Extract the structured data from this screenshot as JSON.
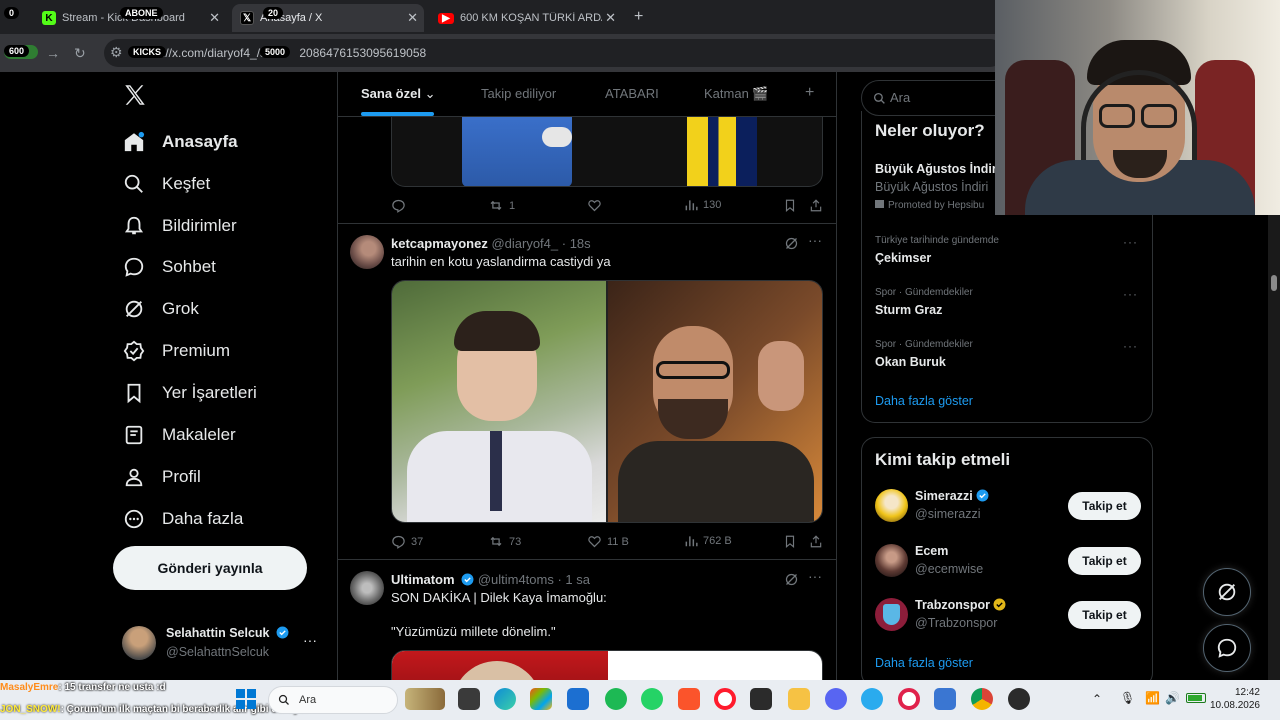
{
  "browser": {
    "tabs": [
      {
        "label": "Stream - Kick Dashboard",
        "active": false
      },
      {
        "label": "Anasayfa / X",
        "active": true
      },
      {
        "label": "600 KM KOŞAN TÜRKİ ARDA S...",
        "active": false
      }
    ],
    "new_tab": "+",
    "url": "https://x.com/diaryof4_/status/2086476153095619058",
    "url_display": "://x.com/diaryof4_/st",
    "url_display_tail": "2086476153095619058"
  },
  "overlays": {
    "abone": "ABONE",
    "abone_count": "20",
    "left_count": "0",
    "kicks": "KICKS",
    "kicks_count": "5000",
    "views": "600"
  },
  "sidebar": {
    "items": [
      {
        "label": "Anasayfa",
        "icon": "home-icon",
        "active": true
      },
      {
        "label": "Keşfet",
        "icon": "search-icon"
      },
      {
        "label": "Bildirimler",
        "icon": "bell-icon"
      },
      {
        "label": "Sohbet",
        "icon": "chat-bubble-icon"
      },
      {
        "label": "Grok",
        "icon": "grok-icon"
      },
      {
        "label": "Premium",
        "icon": "premium-badge-icon"
      },
      {
        "label": "Yer İşaretleri",
        "icon": "bookmark-icon"
      },
      {
        "label": "Makaleler",
        "icon": "article-icon"
      },
      {
        "label": "Profil",
        "icon": "person-icon"
      },
      {
        "label": "Daha fazla",
        "icon": "more-circle-icon"
      }
    ],
    "post_button": "Gönderi yayınla",
    "account": {
      "name": "Selahattin Selcuk",
      "handle": "@SelahattnSelcuk",
      "more": "···"
    }
  },
  "feed": {
    "tabs": [
      {
        "label": "Sana özel",
        "active": true
      },
      {
        "label": "Takip ediliyor"
      },
      {
        "label": "ATABARI"
      },
      {
        "label": "Katman 🎬"
      }
    ],
    "add_tab": "+",
    "tweets": [
      {
        "actions": {
          "replies": "",
          "reposts": "1",
          "likes": "",
          "views": "130"
        }
      },
      {
        "name": "ketcapmayonez",
        "handle": "@diaryof4_",
        "time": "· 18s",
        "text": "tarihin en kotu yaslandirma castiydi ya",
        "actions": {
          "replies": "37",
          "reposts": "73",
          "likes": "11 B",
          "views": "762 B"
        }
      },
      {
        "name": "Ultimatom",
        "handle": "@ultim4toms",
        "time": "· 1 sa",
        "text": "SON DAKİKA | Dilek Kaya İmamoğlu:",
        "quote": "\"Yüzümüzü millete dönelim.\""
      }
    ]
  },
  "right": {
    "search_placeholder": "Ara",
    "trends_title": "Neler oluyor?",
    "promoted": {
      "title": "Büyük Ağustos İndir",
      "subtitle": "Büyük Ağustos İndiri",
      "promoted_by": "Promoted by Hepsibu"
    },
    "trends": [
      {
        "category": "Türkiye tarihinde gündemde",
        "name": "Çekimser"
      },
      {
        "category": "Spor · Gündemdekiler",
        "name": "Sturm Graz"
      },
      {
        "category": "Spor · Gündemdekiler",
        "name": "Okan Buruk"
      }
    ],
    "trends_more": "Daha fazla göster",
    "who_title": "Kimi takip etmeli",
    "who": [
      {
        "name": "Simerazzi",
        "handle": "@simerazzi",
        "badge": "blue"
      },
      {
        "name": "Ecem",
        "handle": "@ecemwise",
        "badge": "none"
      },
      {
        "name": "Trabzonspor",
        "handle": "@Trabzonspor",
        "badge": "gold"
      }
    ],
    "follow_label": "Takip et",
    "who_more": "Daha fazla göster"
  },
  "taskbar": {
    "search": "Ara",
    "time": "12:42",
    "date": "10.08.2026",
    "chat_line1_user": "MasalyEmre",
    "chat_line1_msg": ": 15 transfer ne usta :d",
    "chat_line2_user": "JON_SNOW!",
    "chat_line2_msg": ": Çorum'um ilk maçtan bi beraberlik alır gibi duruyor"
  },
  "colors": {
    "accent": "#1d9bf0",
    "bg": "#000000",
    "text": "#e7e9ea",
    "muted": "#71767b",
    "gold": "#e2b719"
  }
}
